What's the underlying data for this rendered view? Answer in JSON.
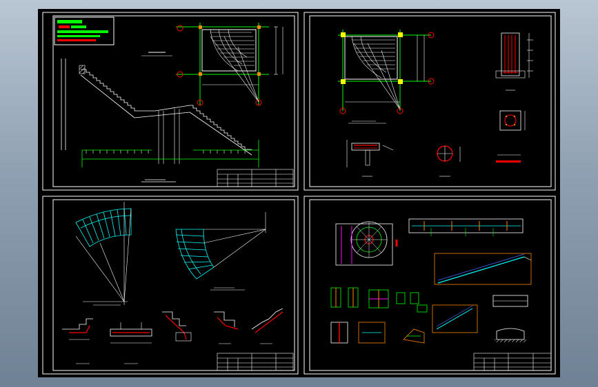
{
  "window": {
    "title": ""
  },
  "colors": {
    "background_top": "#b9c6d3",
    "background_bottom": "#6f8194",
    "canvas": "#000000",
    "frame": "#ffffff",
    "line_white": "#ffffff",
    "line_green": "#00ff00",
    "line_cyan": "#00ffff",
    "line_red": "#ff0000",
    "line_yellow": "#ffff00",
    "line_magenta": "#ff00ff",
    "line_orange": "#ff8800"
  },
  "icons": [
    "title-block",
    "axis-bubble",
    "section-marker"
  ],
  "sheets": {
    "top_left": {
      "labels": {
        "title": "",
        "scale": ""
      }
    },
    "top_right": {
      "labels": {
        "title": ""
      }
    },
    "bottom_left": {
      "labels": {
        "title": "",
        "scale": ""
      }
    },
    "bottom_right": {
      "labels": {
        "title": ""
      }
    }
  }
}
